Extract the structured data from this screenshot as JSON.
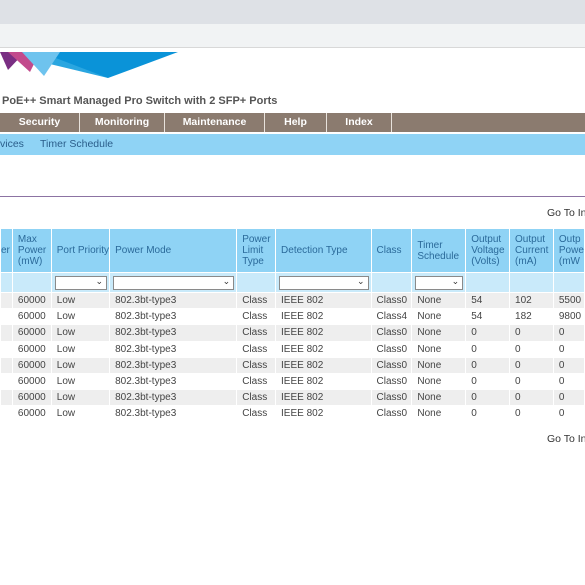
{
  "header": {
    "product_title": "PoE++ Smart Managed Pro Switch with 2 SFP+ Ports"
  },
  "menu": [
    {
      "label": "Security"
    },
    {
      "label": "Monitoring"
    },
    {
      "label": "Maintenance"
    },
    {
      "label": "Help"
    },
    {
      "label": "Index"
    }
  ],
  "submenu": [
    {
      "label": "vices"
    },
    {
      "label": "Timer Schedule"
    }
  ],
  "goto_label": "Go To In",
  "table": {
    "headers": [
      "er",
      "Max Power (mW)",
      "Port Priority",
      "Power Mode",
      "Power Limit Type",
      "Detection Type",
      "Class",
      "Timer Schedule",
      "Output Voltage (Volts)",
      "Output Current (mA)",
      "Outp Powe (mW"
    ],
    "filters": {
      "port_priority": "",
      "power_mode": "",
      "detection_type": "",
      "timer_schedule": ""
    },
    "rows": [
      [
        "",
        "60000",
        "Low",
        "802.3bt-type3",
        "Class",
        "IEEE 802",
        "Class0",
        "None",
        "54",
        "102",
        "5500"
      ],
      [
        "",
        "60000",
        "Low",
        "802.3bt-type3",
        "Class",
        "IEEE 802",
        "Class4",
        "None",
        "54",
        "182",
        "9800"
      ],
      [
        "",
        "60000",
        "Low",
        "802.3bt-type3",
        "Class",
        "IEEE 802",
        "Class0",
        "None",
        "0",
        "0",
        "0"
      ],
      [
        "",
        "60000",
        "Low",
        "802.3bt-type3",
        "Class",
        "IEEE 802",
        "Class0",
        "None",
        "0",
        "0",
        "0"
      ],
      [
        "",
        "60000",
        "Low",
        "802.3bt-type3",
        "Class",
        "IEEE 802",
        "Class0",
        "None",
        "0",
        "0",
        "0"
      ],
      [
        "",
        "60000",
        "Low",
        "802.3bt-type3",
        "Class",
        "IEEE 802",
        "Class0",
        "None",
        "0",
        "0",
        "0"
      ],
      [
        "",
        "60000",
        "Low",
        "802.3bt-type3",
        "Class",
        "IEEE 802",
        "Class0",
        "None",
        "0",
        "0",
        "0"
      ],
      [
        "",
        "60000",
        "Low",
        "802.3bt-type3",
        "Class",
        "IEEE 802",
        "Class0",
        "None",
        "0",
        "0",
        "0"
      ]
    ]
  }
}
